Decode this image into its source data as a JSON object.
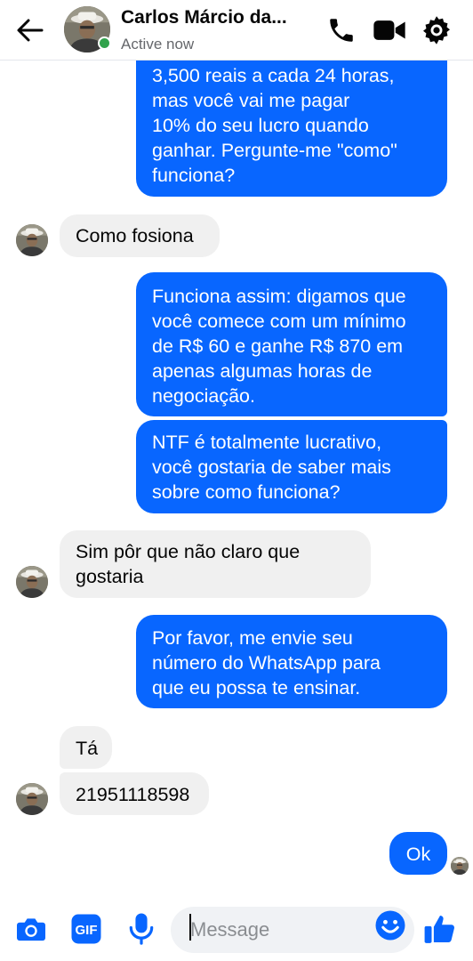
{
  "header": {
    "contact_name": "Carlos Márcio da...",
    "status": "Active now"
  },
  "messages": [
    {
      "side": "outgoing",
      "text": "3,500 reais  a cada 24 horas,\nmas você vai me pagar\n10% do seu lucro quando\nganhar. Pergunte-me \"como\"\nfunciona?"
    },
    {
      "side": "incoming",
      "text": "Como fosiona"
    },
    {
      "side": "outgoing",
      "text": "Funciona assim: digamos que\nvocê comece com um mínimo\nde R$ 60 e ganhe R$ 870 em\napenas algumas horas de\nnegociação."
    },
    {
      "side": "outgoing",
      "text": "NTF é totalmente lucrativo,\nvocê gostaria de saber mais\nsobre como funciona?"
    },
    {
      "side": "incoming",
      "text": "Sim pôr que não claro que\ngostaria"
    },
    {
      "side": "outgoing",
      "text": "Por favor, me envie seu\nnúmero do WhatsApp para\nque eu possa te ensinar."
    },
    {
      "side": "incoming",
      "text": "Tá"
    },
    {
      "side": "incoming",
      "text": "21951118598"
    },
    {
      "side": "outgoing",
      "text": "Ok"
    }
  ],
  "composer": {
    "placeholder": "Message",
    "value": ""
  },
  "icons": {
    "back": "arrow-left-icon",
    "call": "phone-icon",
    "video": "video-camera-icon",
    "settings": "gear-icon",
    "camera": "camera-icon",
    "gif": "gif-icon",
    "mic": "microphone-icon",
    "emoji": "emoji-icon",
    "like": "thumbs-up-icon"
  },
  "colors": {
    "accent": "#0866ff",
    "incoming_bubble": "#f0f0f0",
    "online": "#31a24c"
  }
}
